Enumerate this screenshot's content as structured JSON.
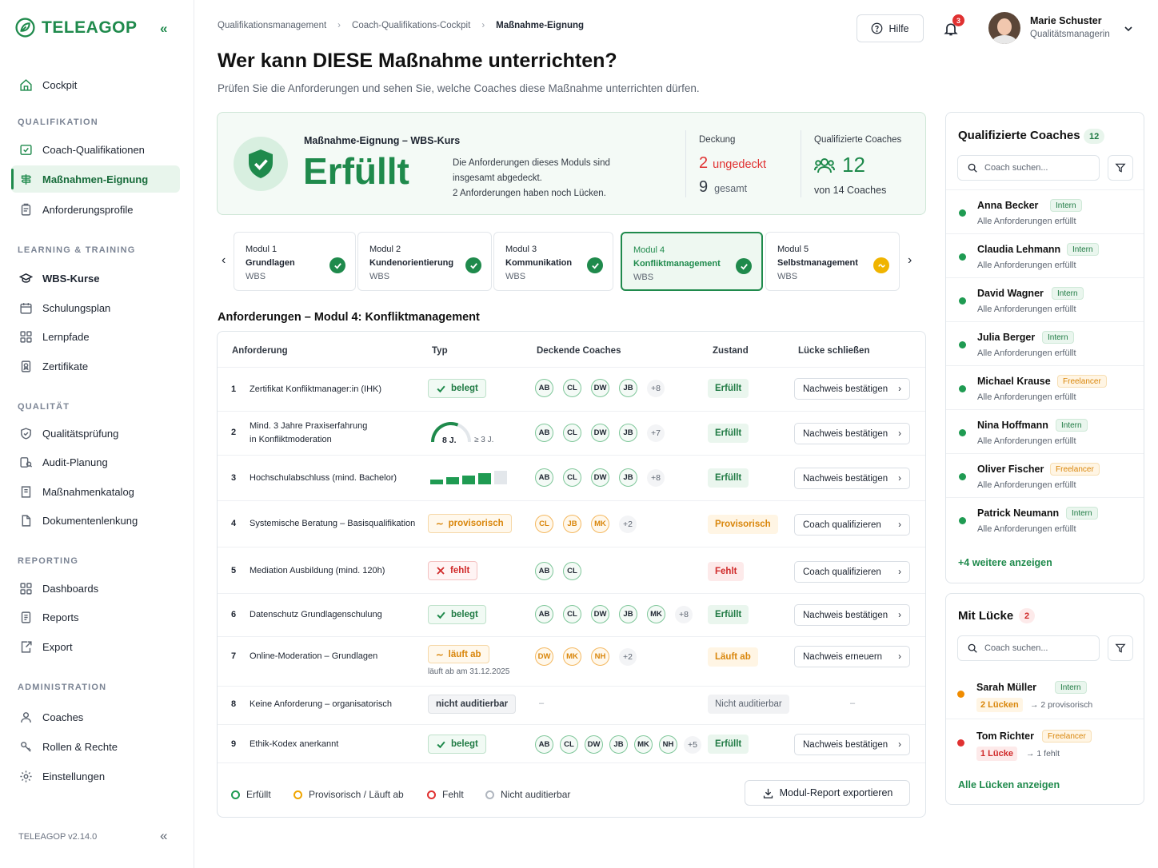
{
  "app": {
    "name": "TELEAGOP",
    "version": "TELEAGOP v2.14.0"
  },
  "sidebar": {
    "cockpit": "Cockpit",
    "sections": [
      {
        "title": "QUALIFIKATION",
        "items": [
          "Coach-Qualifikationen",
          "Maßnahmen-Eignung",
          "Anforderungsprofile"
        ]
      },
      {
        "title": "LEARNING & TRAINING",
        "items": [
          "WBS-Kurse",
          "Schulungsplan",
          "Lernpfade",
          "Zertifikate"
        ]
      },
      {
        "title": "QUALITÄT",
        "items": [
          "Qualitätsprüfung",
          "Audit-Planung",
          "Maßnahmenkatalog",
          "Dokumentenlenkung"
        ]
      },
      {
        "title": "REPORTING",
        "items": [
          "Dashboards",
          "Reports",
          "Export"
        ]
      },
      {
        "title": "ADMINISTRATION",
        "items": [
          "Coaches",
          "Rollen & Rechte",
          "Einstellungen"
        ]
      }
    ]
  },
  "header": {
    "breadcrumb": [
      "Qualifikationsmanagement",
      "Coach-Qualifikations-Cockpit",
      "Maßnahme-Eignung"
    ],
    "help": "Hilfe",
    "notifications": "3",
    "user_name": "Marie Schuster",
    "user_role": "Qualitätsmanagerin"
  },
  "page": {
    "title": "Wer kann DIESE Maßnahme unterrichten?",
    "subtitle": "Prüfen Sie die Anforderungen und sehen Sie, welche Coaches diese Maßnahme unterrichten dürfen."
  },
  "summary": {
    "label": "Maßnahme-Eignung – WBS-Kurs",
    "status": "Erfüllt",
    "desc1": "Die Anforderungen dieses Moduls sind",
    "desc2": "insgesamt abgedeckt.",
    "desc3": "2 Anforderungen haben noch Lücken.",
    "coverage_label": "Deckung",
    "uncovered_num": "2",
    "uncovered_text": "ungedeckt",
    "total_num": "9",
    "total_text": "gesamt",
    "qualified_label": "Qualifizierte Coaches",
    "qualified_num": "12",
    "qualified_of": "von 14 Coaches"
  },
  "modules": [
    {
      "num": "Modul 1",
      "name": "Grundlagen",
      "type": "WBS",
      "status": "ok"
    },
    {
      "num": "Modul 2",
      "name": "Kundenorientierung",
      "type": "WBS",
      "status": "ok"
    },
    {
      "num": "Modul 3",
      "name": "Kommunikation",
      "type": "WBS",
      "status": "ok"
    },
    {
      "num": "Modul 4",
      "name": "Konfliktmanagement",
      "type": "WBS",
      "status": "ok",
      "active": true
    },
    {
      "num": "Modul 5",
      "name": "Selbstmanagement",
      "type": "WBS",
      "status": "warn"
    }
  ],
  "requirements": {
    "title": "Anforderungen – Modul 4: Konfliktmanagement",
    "headers": [
      "Anforderung",
      "Typ",
      "Deckende Coaches",
      "Zustand",
      "Lücke schließen"
    ],
    "rows": [
      {
        "n": "1",
        "req": [
          "Zertifikat Konfliktmanager:in (IHK)"
        ],
        "typ": "belegt",
        "coaches": [
          "AB",
          "CL",
          "DW",
          "JB"
        ],
        "more": "+8",
        "state": "Erfüllt",
        "action": "Nachweis bestätigen"
      },
      {
        "n": "2",
        "req": [
          "Mind. 3 Jahre Praxiserfahrung",
          "in Konfliktmoderation"
        ],
        "gauge_value": "8 J.",
        "gauge_target": "≥ 3 J.",
        "coaches": [
          "AB",
          "CL",
          "DW",
          "JB"
        ],
        "more": "+7",
        "state": "Erfüllt",
        "action": "Nachweis bestätigen"
      },
      {
        "n": "3",
        "req": [
          "Hochschulabschluss (mind. Bachelor)"
        ],
        "level_filled": 4,
        "level_total": 5,
        "coaches": [
          "AB",
          "CL",
          "DW",
          "JB"
        ],
        "more": "+8",
        "state": "Erfüllt",
        "action": "Nachweis bestätigen"
      },
      {
        "n": "4",
        "req": [
          "Systemische Beratung – Basisqualifikation"
        ],
        "typ": "provisorisch",
        "coaches": [
          "CL",
          "JB",
          "MK"
        ],
        "more": "+2",
        "state": "Provisorisch",
        "action": "Coach qualifizieren"
      },
      {
        "n": "5",
        "req": [
          "Mediation Ausbildung (mind. 120h)"
        ],
        "typ": "fehlt",
        "coaches": [
          "AB",
          "CL"
        ],
        "more": "",
        "state": "Fehlt",
        "action": "Coach qualifizieren"
      },
      {
        "n": "6",
        "req": [
          "Datenschutz Grundlagenschulung"
        ],
        "typ": "belegt",
        "coaches": [
          "AB",
          "CL",
          "DW",
          "JB",
          "MK"
        ],
        "more": "+8",
        "state": "Erfüllt",
        "action": "Nachweis bestätigen"
      },
      {
        "n": "7",
        "req": [
          "Online-Moderation – Grundlagen"
        ],
        "typ": "läuft ab",
        "typ_note": "läuft ab am 31.12.2025",
        "coaches": [
          "DW",
          "MK",
          "NH"
        ],
        "more": "+2",
        "state": "Läuft ab",
        "action": "Nachweis erneuern"
      },
      {
        "n": "8",
        "req": [
          "Keine Anforderung – organisatorisch"
        ],
        "typ": "nicht auditierbar",
        "coaches_dash": "–",
        "state": "Nicht auditierbar",
        "action_dash": "–"
      },
      {
        "n": "9",
        "req": [
          "Ethik-Kodex anerkannt"
        ],
        "typ": "belegt",
        "coaches": [
          "AB",
          "CL",
          "DW",
          "JB",
          "MK",
          "NH"
        ],
        "more": "+5",
        "state": "Erfüllt",
        "action": "Nachweis bestätigen"
      }
    ],
    "legend": [
      "Erfüllt",
      "Provisorisch / Läuft ab",
      "Fehlt",
      "Nicht auditierbar"
    ],
    "export": "Modul-Report exportieren"
  },
  "qualified": {
    "title": "Qualifizierte Coaches",
    "count": "12",
    "search_placeholder": "Coach suchen...",
    "coaches": [
      {
        "name": "Anna Becker",
        "tag": "Intern",
        "sub": "Alle Anforderungen erfüllt"
      },
      {
        "name": "Claudia Lehmann",
        "tag": "Intern",
        "sub": "Alle Anforderungen erfüllt"
      },
      {
        "name": "David Wagner",
        "tag": "Intern",
        "sub": "Alle Anforderungen erfüllt"
      },
      {
        "name": "Julia Berger",
        "tag": "Intern",
        "sub": "Alle Anforderungen erfüllt"
      },
      {
        "name": "Michael Krause",
        "tag": "Freelancer",
        "sub": "Alle Anforderungen erfüllt"
      },
      {
        "name": "Nina Hoffmann",
        "tag": "Intern",
        "sub": "Alle Anforderungen erfüllt"
      },
      {
        "name": "Oliver Fischer",
        "tag": "Freelancer",
        "sub": "Alle Anforderungen erfüllt"
      },
      {
        "name": "Patrick Neumann",
        "tag": "Intern",
        "sub": "Alle Anforderungen erfüllt"
      }
    ],
    "more_link": "+4 weitere anzeigen"
  },
  "gaps": {
    "title": "Mit Lücke",
    "count": "2",
    "search_placeholder": "Coach suchen...",
    "coaches": [
      {
        "name": "Sarah Müller",
        "tag": "Intern",
        "gap": "2 Lücken",
        "detail": "→ 2 provisorisch",
        "color": "#f08c00"
      },
      {
        "name": "Tom Richter",
        "tag": "Freelancer",
        "gap": "1 Lücke",
        "detail": "→ 1 fehlt",
        "color": "#e03131"
      }
    ],
    "all_link": "Alle Lücken anzeigen"
  },
  "colors": {
    "brand": "#1f8a4c",
    "warn": "#f0a500",
    "danger": "#e03131"
  }
}
